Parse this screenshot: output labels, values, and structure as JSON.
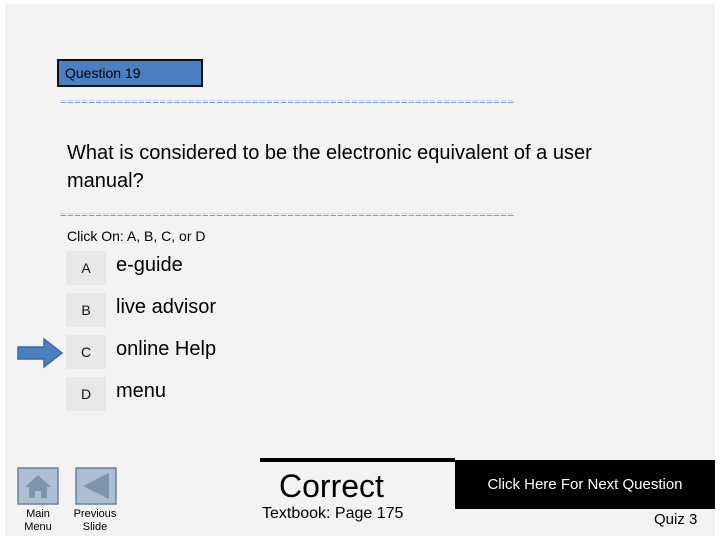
{
  "question": {
    "header": "Question  19",
    "text": "What is considered to be the electronic equivalent of a user manual?",
    "separator": "================================================================",
    "instruction": "Click On: A, B, C, or D"
  },
  "options": [
    {
      "letter": "A",
      "text": "e-guide"
    },
    {
      "letter": "B",
      "text": "live advisor"
    },
    {
      "letter": "C",
      "text": "online Help"
    },
    {
      "letter": "D",
      "text": "menu"
    }
  ],
  "selected_option": "C",
  "result": {
    "status": "Correct",
    "textbook": "Textbook: Page 175"
  },
  "navigation": {
    "main_menu": "Main Menu",
    "previous_slide": "Previous Slide",
    "next_question": "Click  Here For Next Question",
    "quiz_label": "Quiz 3"
  },
  "colors": {
    "accent": "#4a7fc1",
    "background": "#f3f3f3",
    "button_dark": "#000000"
  },
  "icons": {
    "main_menu": "home-icon",
    "previous": "triangle-left-icon",
    "selection": "arrow-right-icon"
  }
}
